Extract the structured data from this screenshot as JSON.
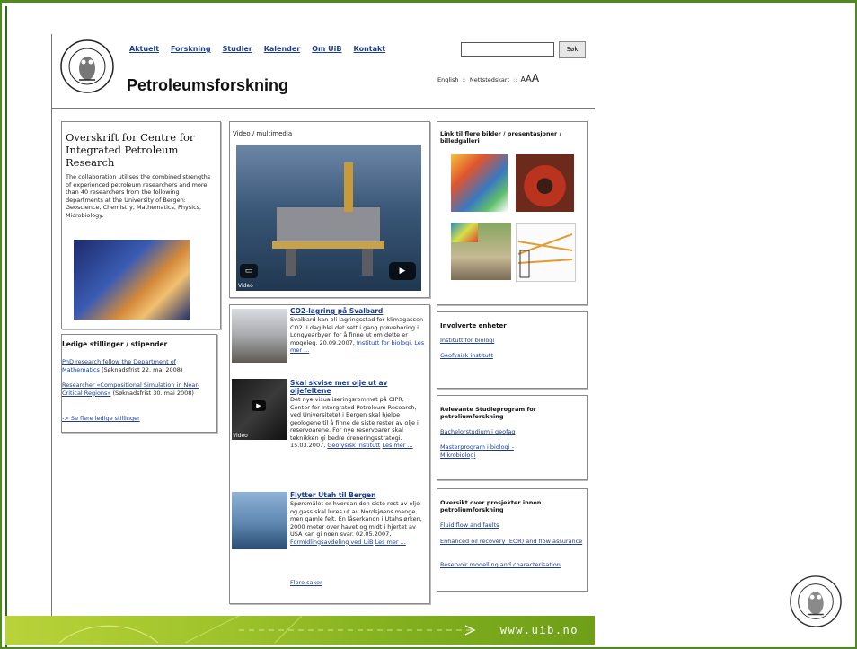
{
  "nav": [
    "Aktuelt",
    "Forskning",
    "Studier",
    "Kalender",
    "Om UiB",
    "Kontakt"
  ],
  "page_title": "Petroleumsforskning",
  "search": {
    "value": "",
    "button": "Søk"
  },
  "util": {
    "english": "English",
    "sep": "::",
    "sitemap": "Nettstedskart",
    "a1": "A",
    "a2": "A",
    "a3": "A"
  },
  "left": {
    "heading": "Overskrift for Centre for Integrated Petroleum Research",
    "body": "The collaboration utilises the combined strengths of experienced petroleum researchers and more than 40 researchers from the following departments at the University of Bergen: Geoscience, Chemistry, Mathematics, Physics, Microbiology."
  },
  "jobs": {
    "heading": "Ledige stillinger / stipender",
    "items": [
      {
        "link": "PhD research fellow the Department of Mathematics",
        "rest": " (Søknadsfrist 22. mai 2008)"
      },
      {
        "link": "Researcher «Compositional Simulation in Near-Critical Regions»",
        "rest": " (Søknadsfrist 30. mai 2008)"
      }
    ],
    "more": "-> Se flere ledige stillinger"
  },
  "video": {
    "label": "Video / multimedia",
    "caption": "Video"
  },
  "news": [
    {
      "title": "CO2-lagring på Svalbard",
      "body": "Svalbard kan bli lagringsstad for klimagassen CO2. I dag blei det sett i gang prøveboring i Longyearbyen for å finne ut om dette er mogeleg. 20.09.2007, ",
      "link1": "Institutt for biologi",
      "link2": "Les mer ..."
    },
    {
      "title": "Skal skvise mer olje ut av oljefeltene",
      "body": "Det nye visualiseringsrommet på CIPR, Center for Intergrated Petroleum Research, ved Universitetet i Bergen skal hjelpe geologene til å finne de siste rester av olje i reservoarene. For nye reservoarer skal teknikken gi bedre dreneringsstrategi. 15.03.2007, ",
      "link1": "Geofysisk Institutt",
      "link2": "Les mer ...",
      "thumb_caption": "Video"
    },
    {
      "title": "Flytter Utah til Bergen",
      "body": "Spørsmålet er hvordan den siste rest av olje og gass skal lures ut av Nordsjøens mange, men gamle felt. En låserkanon i Utahs ørken, 2000 meter over havet og midt i hjertet av USA kan gi noen svar. 02.05.2007, ",
      "link1": "Formidlingsavdeling ved UiB",
      "link2": "Les mer ..."
    }
  ],
  "more_news": "Flere saker",
  "gallery": {
    "heading": "Link til flere bilder / presentasjoner / billedgalleri"
  },
  "units": {
    "heading": "Involverte enheter",
    "items": [
      "Institutt for biologi",
      "Geofysisk institutt"
    ]
  },
  "study": {
    "heading": "Relevante Studieprogram for petroliumforskning",
    "items": [
      "Bachelorstudium i geofag",
      "Masterprogram i biologi - Mikrobiologi"
    ]
  },
  "projects": {
    "heading": "Oversikt over prosjekter innen petroliumforskning",
    "items": [
      "Fluid flow and faults",
      "Enhanced oil recovery (EOR) and flow assurance",
      "Reservoir modelling and characterisation"
    ]
  },
  "footer": "www.uib.no",
  "colors": {
    "link": "#1b3d8f",
    "brand_green": "#7fae1e"
  }
}
